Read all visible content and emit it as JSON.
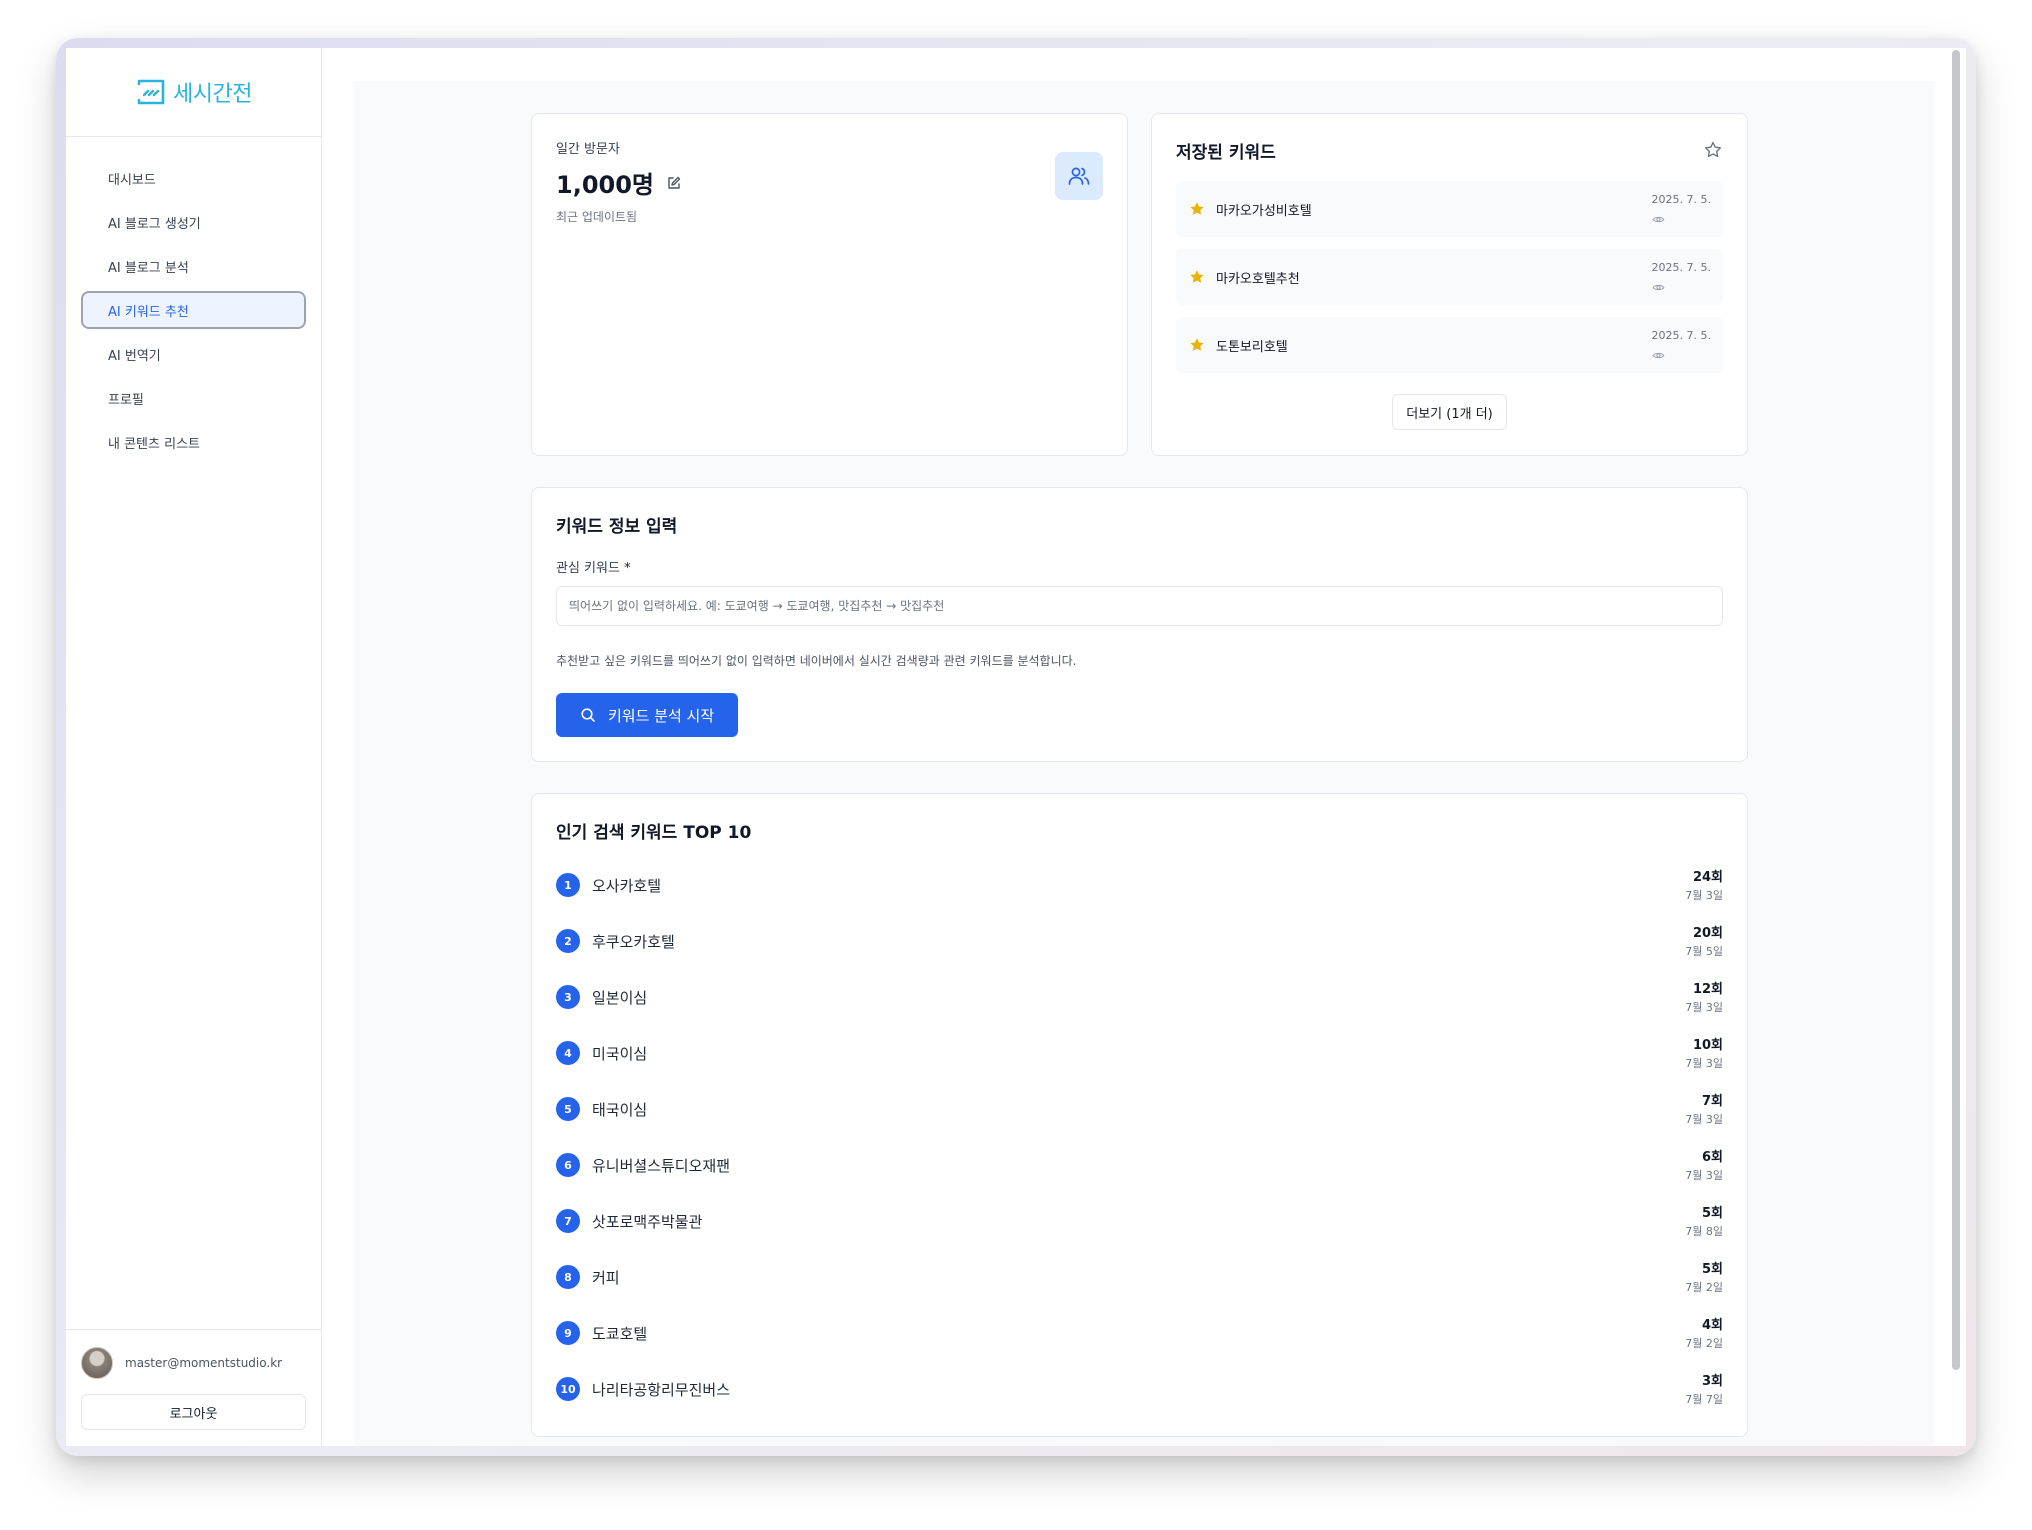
{
  "brand": {
    "name": "세시간전",
    "color": "#2bb3e0"
  },
  "sidebar": {
    "items": [
      {
        "label": "대시보드",
        "active": false
      },
      {
        "label": "AI 블로그 생성기",
        "active": false
      },
      {
        "label": "AI 블로그 분석",
        "active": false
      },
      {
        "label": "AI 키워드 추천",
        "active": true
      },
      {
        "label": "AI 번역기",
        "active": false
      },
      {
        "label": "프로필",
        "active": false
      },
      {
        "label": "내 콘텐츠 리스트",
        "active": false
      }
    ],
    "user_email": "master@momentstudio.kr",
    "logout_label": "로그아웃"
  },
  "visitors": {
    "label": "일간 방문자",
    "count": "1,000명",
    "sub": "최근 업데이트됨",
    "icon": "users-icon"
  },
  "saved": {
    "title": "저장된 키워드",
    "items": [
      {
        "keyword": "마카오가성비호텔",
        "date": "2025. 7. 5."
      },
      {
        "keyword": "마카오호텔추천",
        "date": "2025. 7. 5."
      },
      {
        "keyword": "도톤보리호텔",
        "date": "2025. 7. 5."
      }
    ],
    "more_label": "더보기 (1개 더)"
  },
  "keyword_input": {
    "title": "키워드 정보 입력",
    "field_label": "관심 키워드",
    "required_mark": "*",
    "value": "",
    "placeholder": "띄어쓰기 없이 입력하세요. 예: 도쿄여행 → 도쿄여행, 맛집추천 → 맛집추천",
    "help": "추천받고 싶은 키워드를 띄어쓰기 없이 입력하면 네이버에서 실시간 검색량과 관련 키워드를 분석합니다.",
    "button_label": "키워드 분석 시작"
  },
  "top10": {
    "title": "인기 검색 키워드 TOP 10",
    "items": [
      {
        "rank": "1",
        "keyword": "오사카호텔",
        "count": "24회",
        "date": "7월 3일"
      },
      {
        "rank": "2",
        "keyword": "후쿠오카호텔",
        "count": "20회",
        "date": "7월 5일"
      },
      {
        "rank": "3",
        "keyword": "일본이심",
        "count": "12회",
        "date": "7월 3일"
      },
      {
        "rank": "4",
        "keyword": "미국이심",
        "count": "10회",
        "date": "7월 3일"
      },
      {
        "rank": "5",
        "keyword": "태국이심",
        "count": "7회",
        "date": "7월 3일"
      },
      {
        "rank": "6",
        "keyword": "유니버셜스튜디오재팬",
        "count": "6회",
        "date": "7월 3일"
      },
      {
        "rank": "7",
        "keyword": "삿포로맥주박물관",
        "count": "5회",
        "date": "7월 8일"
      },
      {
        "rank": "8",
        "keyword": "커피",
        "count": "5회",
        "date": "7월 2일"
      },
      {
        "rank": "9",
        "keyword": "도쿄호텔",
        "count": "4회",
        "date": "7월 2일"
      },
      {
        "rank": "10",
        "keyword": "나리타공항리무진버스",
        "count": "3회",
        "date": "7월 7일"
      }
    ]
  },
  "colors": {
    "accent": "#2563eb",
    "star": "#eab308",
    "badge_bg": "#dbeafe"
  }
}
